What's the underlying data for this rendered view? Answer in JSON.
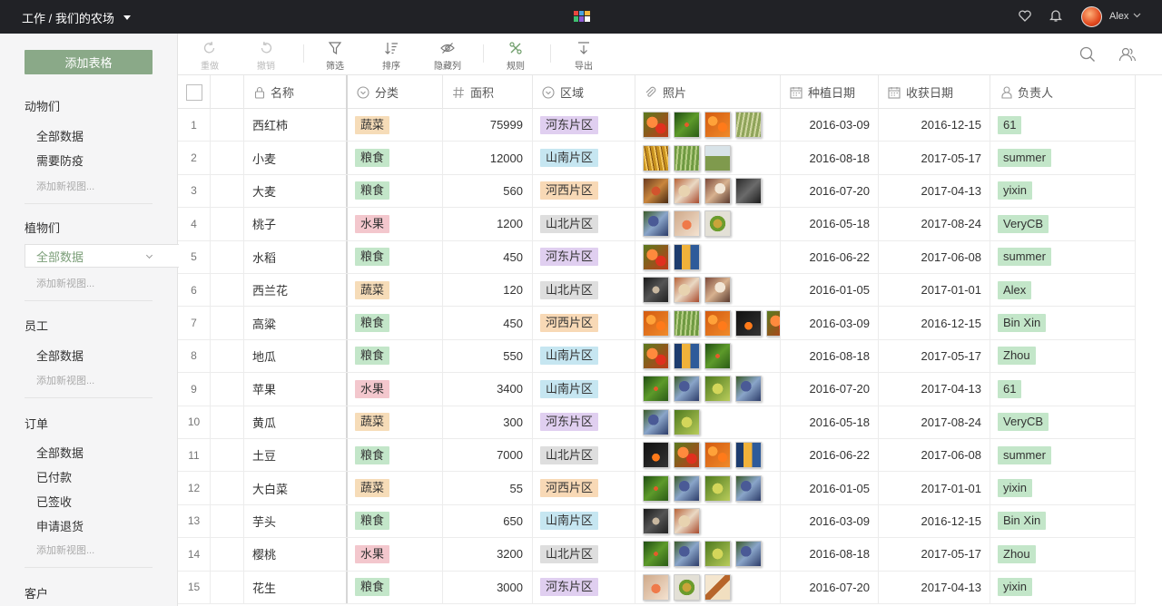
{
  "header": {
    "workspace": "工作 / 我们的农场",
    "user": "Alex"
  },
  "sidebar": {
    "add_table": "添加表格",
    "sections": [
      {
        "title": "动物们",
        "items": [
          "全部数据",
          "需要防疫"
        ],
        "add": "添加新视图..."
      },
      {
        "title": "植物们",
        "items": [
          "全部数据"
        ],
        "active": 0,
        "add": "添加新视图..."
      },
      {
        "title": "员工",
        "items": [
          "全部数据"
        ],
        "add": "添加新视图..."
      },
      {
        "title": "订单",
        "items": [
          "全部数据",
          "已付款",
          "已签收",
          "申请退货"
        ],
        "add": "添加新视图..."
      },
      {
        "title": "客户",
        "items": [],
        "add": ""
      }
    ]
  },
  "toolbar": {
    "redo": "重做",
    "undo": "撤销",
    "filter": "筛选",
    "sort": "排序",
    "hide": "隐藏列",
    "rules": "规则",
    "export": "导出"
  },
  "columns": {
    "name": "名称",
    "category": "分类",
    "area": "面积",
    "region": "区域",
    "photo": "照片",
    "plant_date": "种植日期",
    "harvest_date": "收获日期",
    "owner": "负责人"
  },
  "colors": {
    "蔬菜": "#f6dcb8",
    "粮食": "#c3e6c9",
    "水果": "#f3c7cd",
    "河东片区": "#e0cff0",
    "山南片区": "#c6e6f1",
    "河西片区": "#f8d9b6",
    "山北片区": "#dedede",
    "owner": "#c3e6c9",
    "accent": "#8aa988",
    "topbar": "#212226"
  },
  "rows": [
    {
      "n": "1",
      "name": "西红柿",
      "cat": "蔬菜",
      "area": "75999",
      "region": "河东片区",
      "photos": [
        "p-tomato",
        "p-leaf",
        "p-orange",
        "p-field"
      ],
      "plant": "2016-03-09",
      "harvest": "2016-12-15",
      "owner": "61"
    },
    {
      "n": "2",
      "name": "小麦",
      "cat": "粮食",
      "area": "12000",
      "region": "山南片区",
      "photos": [
        "p-wheat",
        "p-greenwheat",
        "p-meadow"
      ],
      "plant": "2016-08-18",
      "harvest": "2017-05-17",
      "owner": "summer"
    },
    {
      "n": "3",
      "name": "大麦",
      "cat": "粮食",
      "area": "560",
      "region": "河西片区",
      "photos": [
        "p-dish",
        "p-food",
        "p-mixed",
        "p-dark"
      ],
      "plant": "2016-07-20",
      "harvest": "2017-04-13",
      "owner": "yixin"
    },
    {
      "n": "4",
      "name": "桃子",
      "cat": "水果",
      "area": "1200",
      "region": "山北片区",
      "photos": [
        "p-grape",
        "p-salmon",
        "p-bowl"
      ],
      "plant": "2016-05-18",
      "harvest": "2017-08-24",
      "owner": "VeryCB"
    },
    {
      "n": "5",
      "name": "水稻",
      "cat": "粮食",
      "area": "450",
      "region": "河东片区",
      "photos": [
        "p-tomato",
        "p-jar"
      ],
      "plant": "2016-06-22",
      "harvest": "2017-06-08",
      "owner": "summer"
    },
    {
      "n": "6",
      "name": "西兰花",
      "cat": "蔬菜",
      "area": "120",
      "region": "山北片区",
      "photos": [
        "p-darkdish",
        "p-food",
        "p-mixed"
      ],
      "plant": "2016-01-05",
      "harvest": "2017-01-01",
      "owner": "Alex"
    },
    {
      "n": "7",
      "name": "高粱",
      "cat": "粮食",
      "area": "450",
      "region": "河西片区",
      "photos": [
        "p-orange",
        "p-greenwheat",
        "p-orange",
        "p-black",
        "p-tomato"
      ],
      "plant": "2016-03-09",
      "harvest": "2016-12-15",
      "owner": "Bin Xin"
    },
    {
      "n": "8",
      "name": "地瓜",
      "cat": "粮食",
      "area": "550",
      "region": "山南片区",
      "photos": [
        "p-tomato",
        "p-jar",
        "p-leaf"
      ],
      "plant": "2016-08-18",
      "harvest": "2017-05-17",
      "owner": "Zhou"
    },
    {
      "n": "9",
      "name": "苹果",
      "cat": "水果",
      "area": "3400",
      "region": "山南片区",
      "photos": [
        "p-leaf",
        "p-grape",
        "p-greengrape",
        "p-grape"
      ],
      "plant": "2016-07-20",
      "harvest": "2017-04-13",
      "owner": "61"
    },
    {
      "n": "10",
      "name": "黄瓜",
      "cat": "蔬菜",
      "area": "300",
      "region": "河东片区",
      "photos": [
        "p-grape",
        "p-greengrape"
      ],
      "plant": "2016-05-18",
      "harvest": "2017-08-24",
      "owner": "VeryCB"
    },
    {
      "n": "11",
      "name": "土豆",
      "cat": "粮食",
      "area": "7000",
      "region": "山北片区",
      "photos": [
        "p-black",
        "p-tomato",
        "p-orange",
        "p-jar"
      ],
      "plant": "2016-06-22",
      "harvest": "2017-06-08",
      "owner": "summer"
    },
    {
      "n": "12",
      "name": "大白菜",
      "cat": "蔬菜",
      "area": "55",
      "region": "河西片区",
      "photos": [
        "p-leaf",
        "p-grape",
        "p-greengrape",
        "p-grape"
      ],
      "plant": "2016-01-05",
      "harvest": "2017-01-01",
      "owner": "yixin"
    },
    {
      "n": "13",
      "name": "芋头",
      "cat": "粮食",
      "area": "650",
      "region": "山南片区",
      "photos": [
        "p-darkdish",
        "p-food"
      ],
      "plant": "2016-03-09",
      "harvest": "2016-12-15",
      "owner": "Bin Xin"
    },
    {
      "n": "14",
      "name": "樱桃",
      "cat": "水果",
      "area": "3200",
      "region": "山北片区",
      "photos": [
        "p-leaf",
        "p-grape",
        "p-greengrape",
        "p-grape"
      ],
      "plant": "2016-08-18",
      "harvest": "2017-05-17",
      "owner": "Zhou"
    },
    {
      "n": "15",
      "name": "花生",
      "cat": "粮食",
      "area": "3000",
      "region": "河东片区",
      "photos": [
        "p-salmon",
        "p-bowl",
        "p-pastry"
      ],
      "plant": "2016-07-20",
      "harvest": "2017-04-13",
      "owner": "yixin"
    }
  ]
}
